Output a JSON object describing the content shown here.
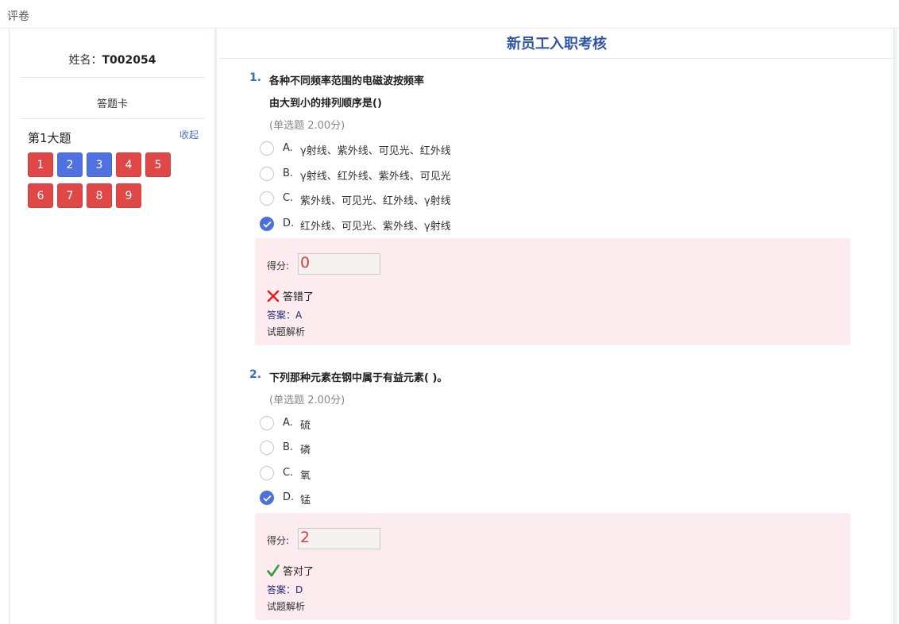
{
  "page": {
    "title": "评卷"
  },
  "sidebar": {
    "name_label": "姓名：",
    "name_value": "T002054",
    "card_title": "答题卡",
    "section_title": "第1大题",
    "collapse_label": "收起",
    "question_numbers": [
      {
        "label": "1",
        "status": "wrong"
      },
      {
        "label": "2",
        "status": "correct"
      },
      {
        "label": "3",
        "status": "correct"
      },
      {
        "label": "4",
        "status": "wrong"
      },
      {
        "label": "5",
        "status": "wrong"
      },
      {
        "label": "6",
        "status": "wrong"
      },
      {
        "label": "7",
        "status": "wrong"
      },
      {
        "label": "8",
        "status": "wrong"
      },
      {
        "label": "9",
        "status": "wrong"
      }
    ]
  },
  "exam": {
    "title": "新员工入职考核",
    "questions": [
      {
        "number": "1.",
        "text_line1": "各种不同频率范围的电磁波按频率",
        "text_line2": "由大到小的排列顺序是()",
        "meta": "(单选题 2.00分)",
        "options": [
          {
            "letter": "A.",
            "text": "γ射线、紫外线、可见光、红外线",
            "checked": false
          },
          {
            "letter": "B.",
            "text": "γ射线、红外线、紫外线、可见光",
            "checked": false
          },
          {
            "letter": "C.",
            "text": "紫外线、可见光、红外线、γ射线",
            "checked": false
          },
          {
            "letter": "D.",
            "text": "红外线、可见光、紫外线、γ射线",
            "checked": true
          }
        ],
        "result": {
          "score_label": "得分:",
          "score": "0",
          "status": "答错了",
          "correct": false,
          "answer": "答案：A",
          "analysis": "试题解析"
        }
      },
      {
        "number": "2.",
        "text_line1": "下列那种元素在钢中属于有益元素( )。",
        "meta": "(单选题 2.00分)",
        "options": [
          {
            "letter": "A.",
            "text": "硫",
            "checked": false
          },
          {
            "letter": "B.",
            "text": "磷",
            "checked": false
          },
          {
            "letter": "C.",
            "text": "氧",
            "checked": false
          },
          {
            "letter": "D.",
            "text": "锰",
            "checked": true
          }
        ],
        "result": {
          "score_label": "得分:",
          "score": "2",
          "status": "答对了",
          "correct": true,
          "answer": "答案：D",
          "analysis": "试题解析"
        }
      }
    ]
  },
  "colors": {
    "wrong": "#e04747",
    "correct": "#4f72e0",
    "accent": "#2f55a4",
    "result_bg": "#fdecef"
  }
}
